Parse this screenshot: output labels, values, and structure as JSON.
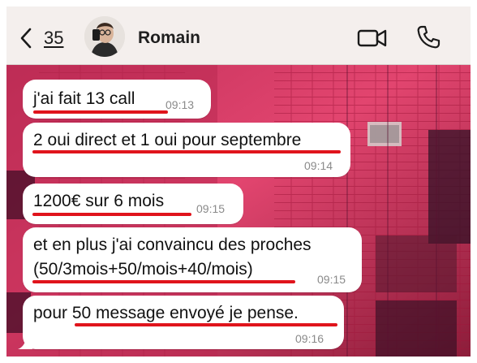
{
  "header": {
    "back_count": "35",
    "contact_name": "Romain"
  },
  "messages": [
    {
      "text": "j'ai fait 13 call",
      "time": "09:13"
    },
    {
      "text": "2 oui direct et 1 oui pour septembre",
      "time": "09:14"
    },
    {
      "text": "1200€ sur 6 mois",
      "time": "09:15"
    },
    {
      "line1": "et en plus j'ai convaincu des proches",
      "line2": "(50/3mois+50/mois+40/mois)",
      "time": "09:15"
    },
    {
      "text": "pour 50 message envoyé je pense.",
      "time": "09:16"
    }
  ],
  "colors": {
    "header_bg": "#f4efed",
    "bubble_bg": "#ffffff",
    "underline": "#e0141c",
    "timestamp": "#8a8a8a"
  },
  "icons": [
    "chevron-left-icon",
    "video-call-icon",
    "phone-call-icon"
  ]
}
